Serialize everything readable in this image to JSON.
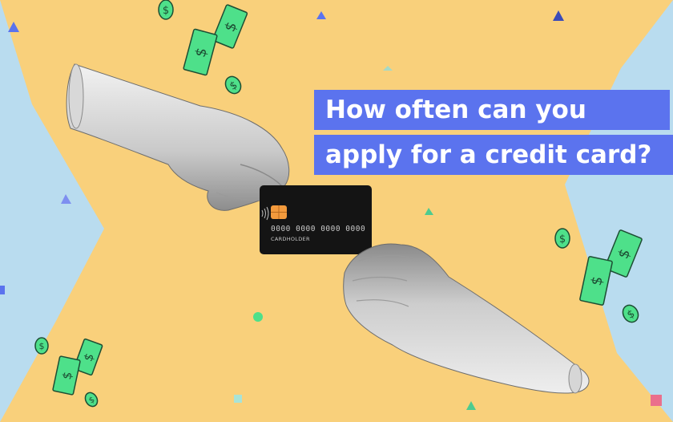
{
  "headline": {
    "line1": "How often can you",
    "line2": "apply for a credit card?"
  },
  "card": {
    "number": "0000 0000 0000 0000",
    "holder": "CARDHOLDER"
  },
  "colors": {
    "background_blue": "#b9dcef",
    "background_yellow": "#f9d07b",
    "banner_blue": "#5b73ee",
    "money_green": "#4ee08a",
    "card_black": "#141414",
    "chip_orange": "#f39a3c"
  },
  "icons": [
    "dollar-bill-icon",
    "dollar-coin-icon",
    "triangle-shape",
    "circle-shape",
    "square-shape"
  ]
}
